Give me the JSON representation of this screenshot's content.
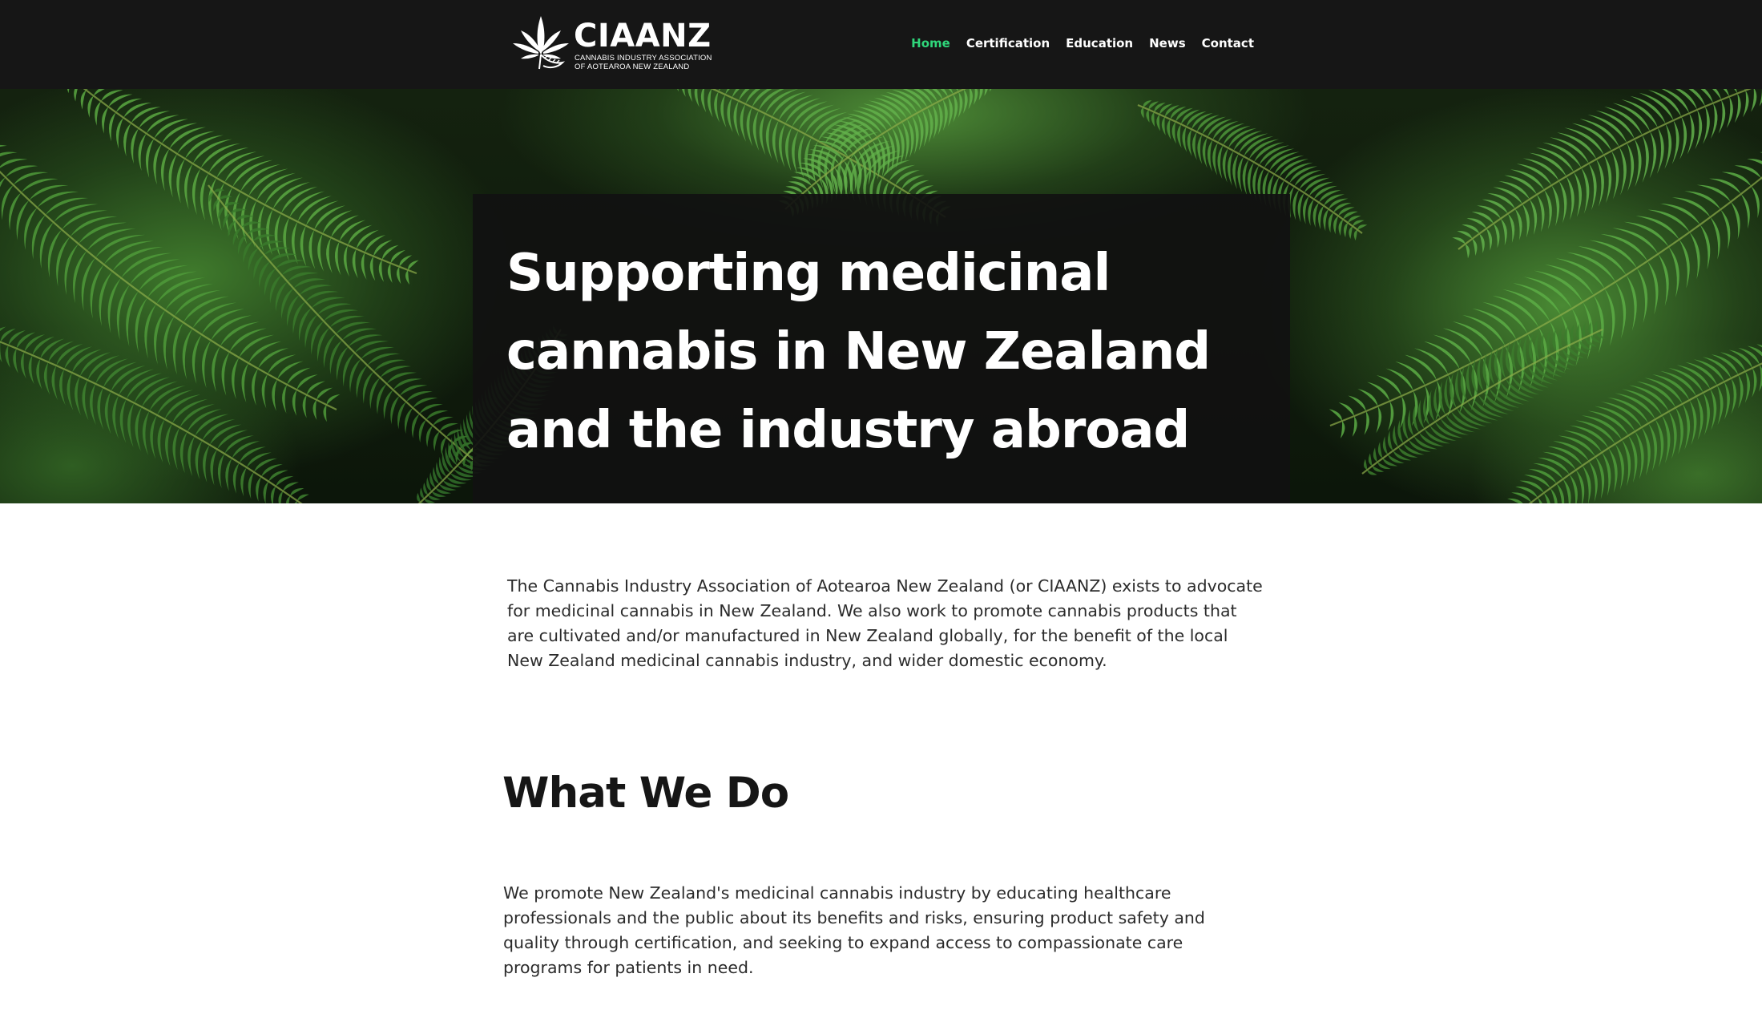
{
  "header": {
    "logo": {
      "wordmark": "CIAANZ",
      "subtitle_line1": "CANNABIS INDUSTRY ASSOCIATION",
      "subtitle_line2": "OF AOTEAROA NEW ZEALAND"
    },
    "nav": [
      {
        "label": "Home",
        "active": true
      },
      {
        "label": "Certification",
        "active": false
      },
      {
        "label": "Education",
        "active": false
      },
      {
        "label": "News",
        "active": false
      },
      {
        "label": "Contact",
        "active": false
      }
    ]
  },
  "hero": {
    "title": "Supporting medicinal cannabis in New Zealand and the industry abroad",
    "background": "fern-leaves"
  },
  "intro": {
    "text": "The Cannabis Industry Association of Aotearoa New Zealand (or CIAANZ) exists to advocate for medicinal cannabis in New Zealand. We also work to promote cannabis products that are cultivated and/or manufactured in New Zealand globally, for the benefit of the local New Zealand medicinal cannabis industry, and wider domestic economy."
  },
  "what_we_do": {
    "title": "What We Do",
    "text": "We promote New Zealand's medicinal cannabis industry by educating healthcare professionals and the public about its benefits and risks, ensuring product safety and quality through certification, and seeking to expand access to compassionate care programs for patients in need."
  },
  "colors": {
    "header_bg": "#161616",
    "nav_active": "#2fd67a",
    "nav_text": "#ffffff",
    "hero_panel_bg": "#111111",
    "body_text": "#2b2b2b",
    "heading_text": "#161616"
  },
  "icons": {
    "logo_mark": "cannabis-leaf-fern-icon"
  }
}
